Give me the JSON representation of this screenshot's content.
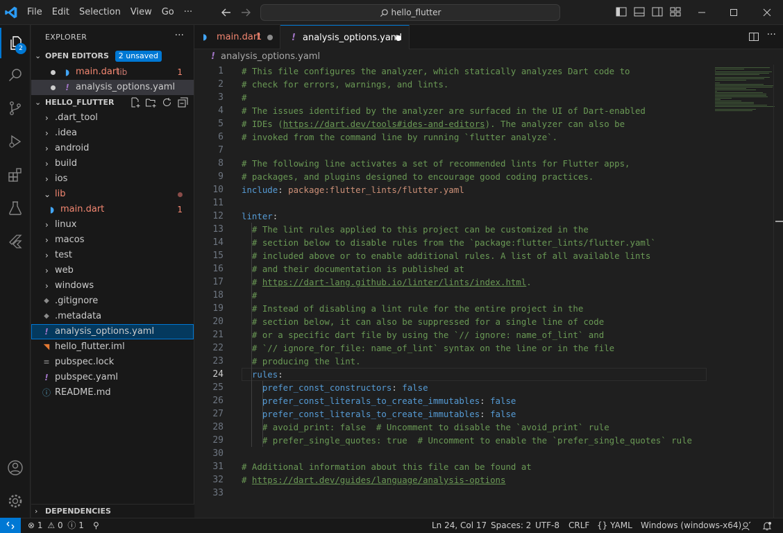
{
  "titlebar": {
    "menu": [
      "File",
      "Edit",
      "Selection",
      "View",
      "Go",
      "···"
    ],
    "search_text": "hello_flutter"
  },
  "activity": {
    "explorer_badge": "2"
  },
  "sidebar": {
    "title": "EXPLORER",
    "more": "···",
    "open_editors": {
      "header": "OPEN EDITORS",
      "badge": "2 unsaved",
      "items": [
        {
          "name": "main.dart",
          "desc": "lib",
          "problems": "1"
        },
        {
          "name": "analysis_options.yaml"
        }
      ]
    },
    "folder": {
      "header": "HELLO_FLUTTER",
      "items": [
        {
          "name": ".dart_tool"
        },
        {
          "name": ".idea"
        },
        {
          "name": "android"
        },
        {
          "name": "build"
        },
        {
          "name": "ios"
        },
        {
          "name": "lib"
        },
        {
          "name": "main.dart",
          "problems": "1"
        },
        {
          "name": "linux"
        },
        {
          "name": "macos"
        },
        {
          "name": "test"
        },
        {
          "name": "web"
        },
        {
          "name": "windows"
        },
        {
          "name": ".gitignore"
        },
        {
          "name": ".metadata"
        },
        {
          "name": "analysis_options.yaml"
        },
        {
          "name": "hello_flutter.iml"
        },
        {
          "name": "pubspec.lock"
        },
        {
          "name": "pubspec.yaml"
        },
        {
          "name": "README.md"
        }
      ]
    },
    "dependencies": "DEPENDENCIES"
  },
  "tabs": [
    {
      "label": "main.dart",
      "problems": "1"
    },
    {
      "label": "analysis_options.yaml"
    }
  ],
  "breadcrumb": "analysis_options.yaml",
  "editor": {
    "current_line": 24,
    "lines": [
      [
        [
          "c",
          "# This file configures the analyzer, which statically analyzes Dart code to"
        ]
      ],
      [
        [
          "c",
          "# check for errors, warnings, and lints."
        ]
      ],
      [
        [
          "c",
          "#"
        ]
      ],
      [
        [
          "c",
          "# The issues identified by the analyzer are surfaced in the UI of Dart-enabled"
        ]
      ],
      [
        [
          "c",
          "# IDEs ("
        ],
        [
          "cu",
          "https://dart.dev/tools#ides-and-editors"
        ],
        [
          "c",
          "). The analyzer can also be"
        ]
      ],
      [
        [
          "c",
          "# invoked from the command line by running `flutter analyze`."
        ]
      ],
      [],
      [
        [
          "c",
          "# The following line activates a set of recommended lints for Flutter apps,"
        ]
      ],
      [
        [
          "c",
          "# packages, and plugins designed to encourage good coding practices."
        ]
      ],
      [
        [
          "k",
          "include"
        ],
        [
          "p",
          ": "
        ],
        [
          "s",
          "package:flutter_lints/flutter.yaml"
        ]
      ],
      [],
      [
        [
          "k",
          "linter"
        ],
        [
          "p",
          ":"
        ]
      ],
      [
        [
          "p",
          "  "
        ],
        [
          "c",
          "# The lint rules applied to this project can be customized in the"
        ]
      ],
      [
        [
          "p",
          "  "
        ],
        [
          "c",
          "# section below to disable rules from the `package:flutter_lints/flutter.yaml`"
        ]
      ],
      [
        [
          "p",
          "  "
        ],
        [
          "c",
          "# included above or to enable additional rules. A list of all available lints"
        ]
      ],
      [
        [
          "p",
          "  "
        ],
        [
          "c",
          "# and their documentation is published at"
        ]
      ],
      [
        [
          "p",
          "  "
        ],
        [
          "c",
          "# "
        ],
        [
          "cu",
          "https://dart-lang.github.io/linter/lints/index.html"
        ],
        [
          "c",
          "."
        ]
      ],
      [
        [
          "p",
          "  "
        ],
        [
          "c",
          "#"
        ]
      ],
      [
        [
          "p",
          "  "
        ],
        [
          "c",
          "# Instead of disabling a lint rule for the entire project in the"
        ]
      ],
      [
        [
          "p",
          "  "
        ],
        [
          "c",
          "# section below, it can also be suppressed for a single line of code"
        ]
      ],
      [
        [
          "p",
          "  "
        ],
        [
          "c",
          "# or a specific dart file by using the `// ignore: name_of_lint` and"
        ]
      ],
      [
        [
          "p",
          "  "
        ],
        [
          "c",
          "# `// ignore_for_file: name_of_lint` syntax on the line or in the file"
        ]
      ],
      [
        [
          "p",
          "  "
        ],
        [
          "c",
          "# producing the lint."
        ]
      ],
      [
        [
          "p",
          "  "
        ],
        [
          "k",
          "rules"
        ],
        [
          "p",
          ":"
        ]
      ],
      [
        [
          "p",
          "    "
        ],
        [
          "k",
          "prefer_const_constructors"
        ],
        [
          "p",
          ": "
        ],
        [
          "k",
          "false"
        ]
      ],
      [
        [
          "p",
          "    "
        ],
        [
          "k",
          "prefer_const_literals_to_create_immutables"
        ],
        [
          "p",
          ": "
        ],
        [
          "k",
          "false"
        ]
      ],
      [
        [
          "p",
          "    "
        ],
        [
          "k",
          "prefer_const_literals_to_create_immutables"
        ],
        [
          "p",
          ": "
        ],
        [
          "k",
          "false"
        ]
      ],
      [
        [
          "p",
          "    "
        ],
        [
          "c",
          "# avoid_print: false  # Uncomment to disable the `avoid_print` rule"
        ]
      ],
      [
        [
          "p",
          "    "
        ],
        [
          "c",
          "# prefer_single_quotes: true  # Uncomment to enable the `prefer_single_quotes` rule"
        ]
      ],
      [],
      [
        [
          "c",
          "# Additional information about this file can be found at"
        ]
      ],
      [
        [
          "c",
          "# "
        ],
        [
          "cu",
          "https://dart.dev/guides/language/analysis-options"
        ]
      ],
      []
    ]
  },
  "status": {
    "errors": "1",
    "warnings": "0",
    "infos": "1",
    "position": "Ln 24, Col 17",
    "spaces": "Spaces: 2",
    "encoding": "UTF-8",
    "eol": "CRLF",
    "language": "YAML",
    "platform": "Windows (windows-x64)"
  },
  "colors": {
    "accent": "#0078d4",
    "error": "#f48771",
    "comment": "#6a9955",
    "keyword": "#569cd6",
    "string": "#ce9178",
    "yaml_icon": "#a074c4"
  }
}
